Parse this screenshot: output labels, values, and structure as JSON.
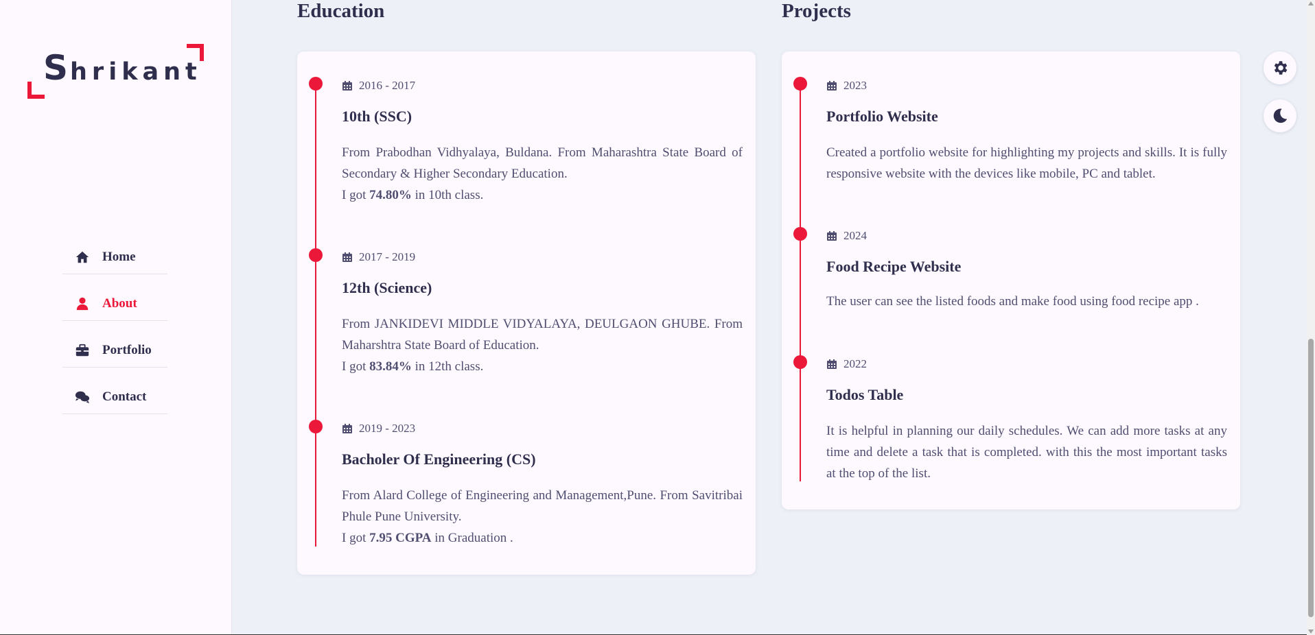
{
  "brand": {
    "first_letter": "S",
    "rest": "hrikant",
    "accent_color": "#ec1839"
  },
  "nav": {
    "items": [
      {
        "label": "Home",
        "icon": "home-icon",
        "active": false
      },
      {
        "label": "About",
        "icon": "user-icon",
        "active": true
      },
      {
        "label": "Portfolio",
        "icon": "briefcase-icon",
        "active": false
      },
      {
        "label": "Contact",
        "icon": "comments-icon",
        "active": false
      }
    ]
  },
  "education": {
    "title": "Education",
    "items": [
      {
        "date": "2016 - 2017",
        "title": "10th (SSC)",
        "text": "From Prabodhan Vidhyalaya, Buldana. From Maharashtra State Board of Secondary & Higher Secondary Education.",
        "result_prefix": "I got ",
        "result_value": "74.80%",
        "result_suffix": " in 10th class."
      },
      {
        "date": "2017 - 2019",
        "title": "12th (Science)",
        "text": "From JANKIDEVI MIDDLE VIDYALAYA, DEULGAON GHUBE. From Maharshtra State Board of Education.",
        "result_prefix": "I got ",
        "result_value": "83.84%",
        "result_suffix": " in 12th class."
      },
      {
        "date": "2019 - 2023",
        "title": "Bacholer Of Engineering (CS)",
        "text": "From Alard College of Engineering and Management,Pune. From Savitribai Phule Pune University.",
        "result_prefix": "I got ",
        "result_value": "7.95 CGPA",
        "result_suffix": " in Graduation ."
      }
    ]
  },
  "projects": {
    "title": "Projects",
    "items": [
      {
        "date": "2023",
        "title": "Portfolio Website",
        "text": "Created a portfolio website for highlighting my projects and skills. It is fully responsive website with the devices like mobile, PC and tablet."
      },
      {
        "date": "2024",
        "title": "Food Recipe Website",
        "text": "The user can see the listed foods and make food using food recipe app ."
      },
      {
        "date": "2022",
        "title": "Todos Table",
        "text": "It is helpful in planning our daily schedules. We can add more tasks at any time and delete a task that is completed. with this the most important tasks at the top of the list."
      }
    ]
  },
  "tools": {
    "settings_icon": "gear-icon",
    "theme_icon": "moon-icon"
  }
}
